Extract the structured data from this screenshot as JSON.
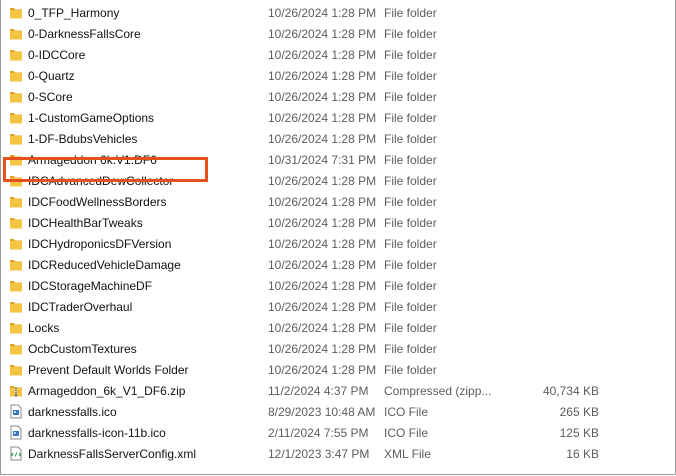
{
  "files": [
    {
      "name": "0_TFP_Harmony",
      "date": "10/26/2024 1:28 PM",
      "type": "File folder",
      "size": "",
      "icon": "folder-icon"
    },
    {
      "name": "0-DarknessFallsCore",
      "date": "10/26/2024 1:28 PM",
      "type": "File folder",
      "size": "",
      "icon": "folder-icon"
    },
    {
      "name": "0-IDCCore",
      "date": "10/26/2024 1:28 PM",
      "type": "File folder",
      "size": "",
      "icon": "folder-icon"
    },
    {
      "name": "0-Quartz",
      "date": "10/26/2024 1:28 PM",
      "type": "File folder",
      "size": "",
      "icon": "folder-icon"
    },
    {
      "name": "0-SCore",
      "date": "10/26/2024 1:28 PM",
      "type": "File folder",
      "size": "",
      "icon": "folder-icon"
    },
    {
      "name": "1-CustomGameOptions",
      "date": "10/26/2024 1:28 PM",
      "type": "File folder",
      "size": "",
      "icon": "folder-icon"
    },
    {
      "name": "1-DF-BdubsVehicles",
      "date": "10/26/2024 1:28 PM",
      "type": "File folder",
      "size": "",
      "icon": "folder-icon"
    },
    {
      "name": "Armageddon 6k.V1.DF6",
      "date": "10/31/2024 7:31 PM",
      "type": "File folder",
      "size": "",
      "icon": "folder-icon",
      "highlighted": true
    },
    {
      "name": "IDCAdvancedDewCollector",
      "date": "10/26/2024 1:28 PM",
      "type": "File folder",
      "size": "",
      "icon": "folder-icon"
    },
    {
      "name": "IDCFoodWellnessBorders",
      "date": "10/26/2024 1:28 PM",
      "type": "File folder",
      "size": "",
      "icon": "folder-icon"
    },
    {
      "name": "IDCHealthBarTweaks",
      "date": "10/26/2024 1:28 PM",
      "type": "File folder",
      "size": "",
      "icon": "folder-icon"
    },
    {
      "name": "IDCHydroponicsDFVersion",
      "date": "10/26/2024 1:28 PM",
      "type": "File folder",
      "size": "",
      "icon": "folder-icon"
    },
    {
      "name": "IDCReducedVehicleDamage",
      "date": "10/26/2024 1:28 PM",
      "type": "File folder",
      "size": "",
      "icon": "folder-icon"
    },
    {
      "name": "IDCStorageMachineDF",
      "date": "10/26/2024 1:28 PM",
      "type": "File folder",
      "size": "",
      "icon": "folder-icon"
    },
    {
      "name": "IDCTraderOverhaul",
      "date": "10/26/2024 1:28 PM",
      "type": "File folder",
      "size": "",
      "icon": "folder-icon"
    },
    {
      "name": "Locks",
      "date": "10/26/2024 1:28 PM",
      "type": "File folder",
      "size": "",
      "icon": "folder-icon"
    },
    {
      "name": "OcbCustomTextures",
      "date": "10/26/2024 1:28 PM",
      "type": "File folder",
      "size": "",
      "icon": "folder-icon"
    },
    {
      "name": "Prevent Default Worlds Folder",
      "date": "10/26/2024 1:28 PM",
      "type": "File folder",
      "size": "",
      "icon": "folder-icon"
    },
    {
      "name": "Armageddon_6k_V1_DF6.zip",
      "date": "11/2/2024 4:37 PM",
      "type": "Compressed (zipp...",
      "size": "40,734 KB",
      "icon": "zip-folder-icon"
    },
    {
      "name": "darknessfalls.ico",
      "date": "8/29/2023 10:48 AM",
      "type": "ICO File",
      "size": "265 KB",
      "icon": "ico-file-icon"
    },
    {
      "name": "darknessfalls-icon-11b.ico",
      "date": "2/11/2024 7:55 PM",
      "type": "ICO File",
      "size": "125 KB",
      "icon": "ico-file-icon"
    },
    {
      "name": "DarknessFallsServerConfig.xml",
      "date": "12/1/2023 3:47 PM",
      "type": "XML File",
      "size": "16 KB",
      "icon": "xml-file-icon"
    }
  ],
  "colors": {
    "highlight": "#e4511e",
    "folder": "#f5c542",
    "folder_dark": "#e0a526",
    "ico_blue": "#3b78c4"
  }
}
